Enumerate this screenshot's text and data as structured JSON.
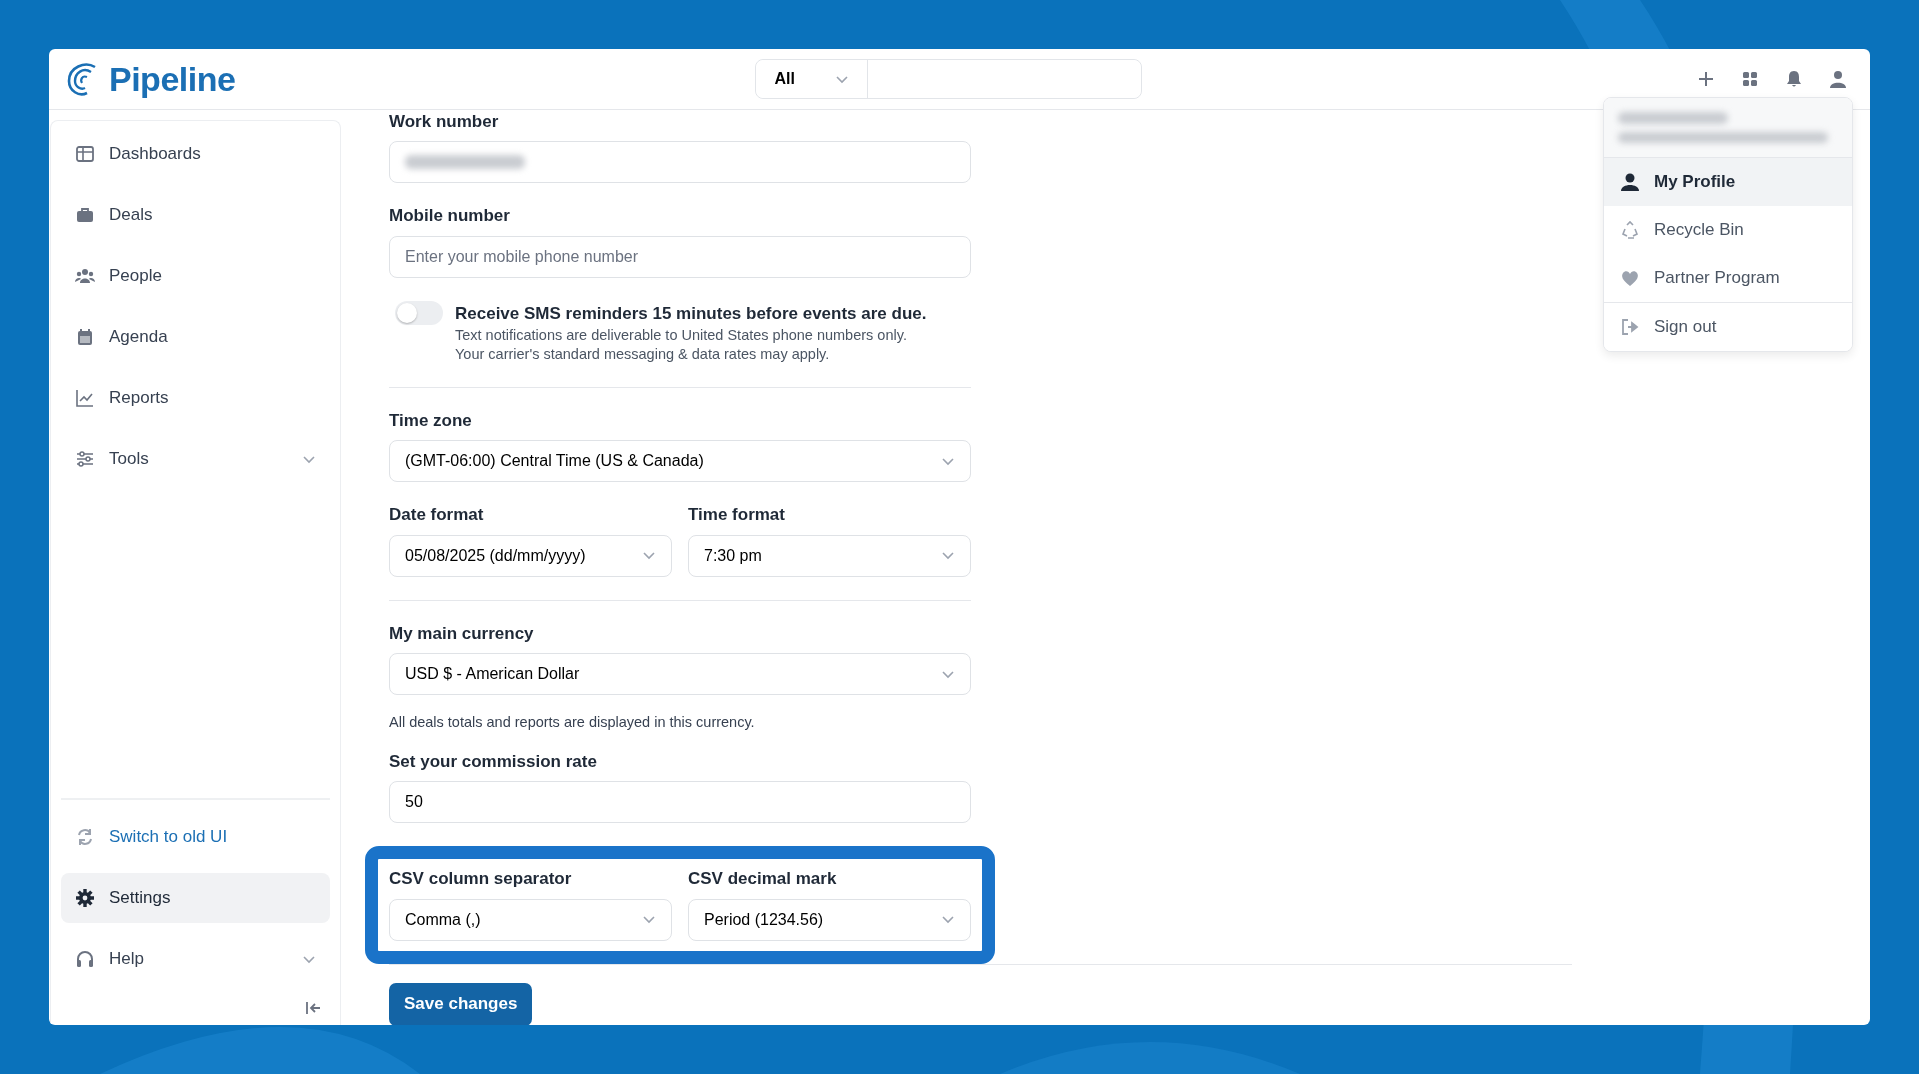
{
  "app": {
    "logo": "Pipeline"
  },
  "search": {
    "scope": "All"
  },
  "sidebar": {
    "items": [
      {
        "label": "Dashboards",
        "selected": false
      },
      {
        "label": "Deals",
        "selected": false
      },
      {
        "label": "People",
        "selected": false
      },
      {
        "label": "Agenda",
        "selected": false
      },
      {
        "label": "Reports",
        "selected": false
      },
      {
        "label": "Tools",
        "selected": false,
        "expanded": false
      }
    ],
    "bottom_items": [
      {
        "label": "Switch to old UI",
        "kind": "link",
        "selected": false
      },
      {
        "label": "Settings",
        "kind": "item",
        "selected": true
      },
      {
        "label": "Help",
        "kind": "item",
        "selected": false,
        "expanded": false
      }
    ]
  },
  "form": {
    "fields": [
      {
        "kind": "input",
        "label": "Work number",
        "value_hidden": true
      },
      {
        "kind": "input",
        "label": "Mobile number",
        "placeholder": "Enter your mobile phone number"
      },
      {
        "kind": "toggle",
        "label": "Receive SMS reminders 15 minutes before events are due.",
        "on": false,
        "help": [
          "Text notifications are deliverable to United States phone numbers only.",
          "Your carrier's standard messaging & data rates may apply."
        ]
      },
      {
        "kind": "divider"
      },
      {
        "kind": "select",
        "label": "Time zone",
        "value": "(GMT-06:00) Central Time (US & Canada)"
      },
      {
        "kind": "row",
        "highlighted": false,
        "fields": [
          {
            "label": "Date format",
            "value": "05/08/2025 (dd/mm/yyyy)"
          },
          {
            "label": "Time format",
            "value": "7:30 pm"
          }
        ]
      },
      {
        "kind": "divider"
      },
      {
        "kind": "select",
        "label": "My main currency",
        "value": "USD $ - American Dollar"
      },
      {
        "kind": "note",
        "text": "All deals totals and reports are displayed in this currency."
      },
      {
        "kind": "input",
        "label": "Set your commission rate",
        "value": "50"
      },
      {
        "kind": "row",
        "highlighted": true,
        "fields": [
          {
            "label": "CSV column separator",
            "value": "Comma (,)"
          },
          {
            "label": "CSV decimal mark",
            "value": "Period (1234.56)"
          }
        ]
      }
    ],
    "save_button": "Save changes"
  },
  "user_menu": {
    "account_hidden": true,
    "items": [
      {
        "label": "My Profile",
        "selected": true
      },
      {
        "label": "Recycle Bin",
        "selected": false
      },
      {
        "label": "Partner Program",
        "selected": false
      },
      {
        "label": "Sign out",
        "selected": false
      }
    ]
  }
}
